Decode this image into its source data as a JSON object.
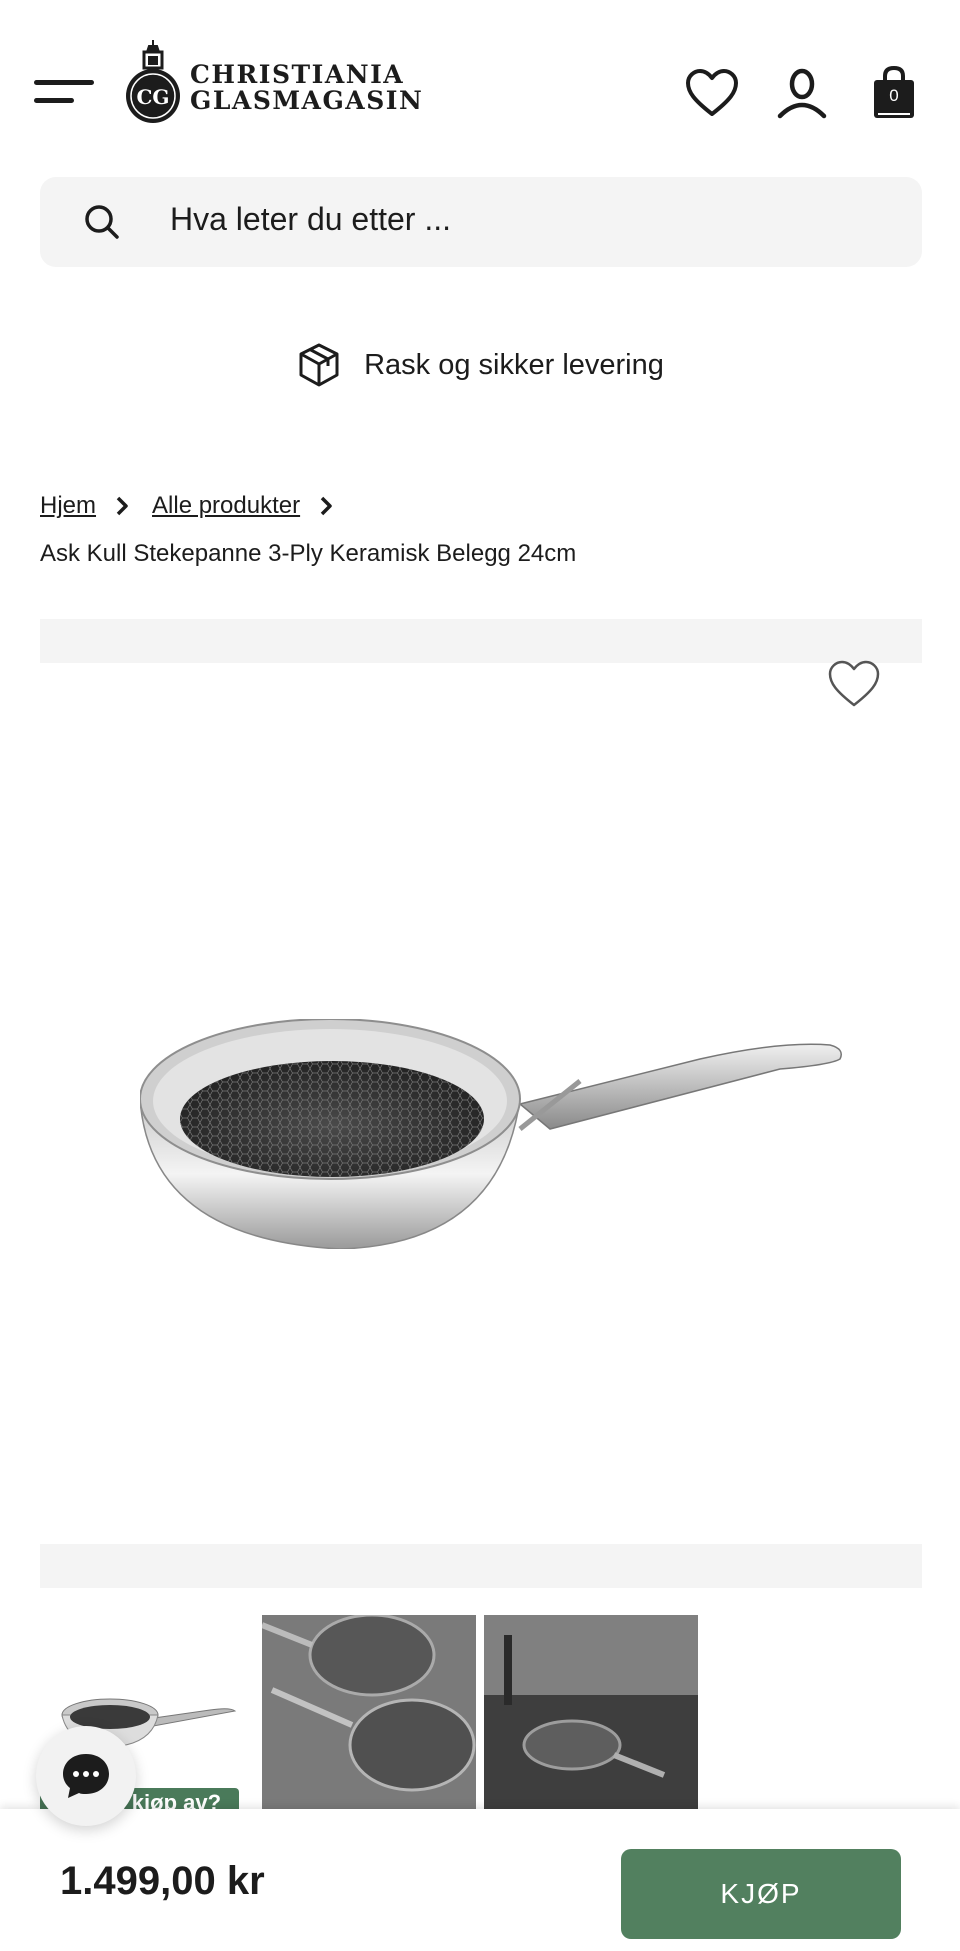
{
  "header": {
    "brand_line1": "CHRISTIANIA",
    "brand_line2": "GLASMAGASIN",
    "logo_monogram": "CG",
    "cart_count": "0",
    "icons": [
      "menu-icon",
      "heart-icon",
      "user-icon",
      "shopping-bag-icon"
    ]
  },
  "search": {
    "placeholder": "Hva leter du etter ...",
    "icon": "search-icon"
  },
  "delivery": {
    "text": "Rask og sikker levering",
    "icon": "package-icon"
  },
  "breadcrumb": {
    "items": [
      "Hjem",
      "Alle produkter"
    ]
  },
  "product": {
    "title": "Ask Kull Stekepanne 3-Ply Keramisk Belegg 24cm",
    "price": "1.499,00 kr",
    "buy_label": "KJØP",
    "badge_text": "ed kjøp av?"
  },
  "colors": {
    "accent": "#52805f",
    "badge": "#4a7a5a",
    "panel": "#f4f4f4",
    "text": "#1c1c1c"
  }
}
